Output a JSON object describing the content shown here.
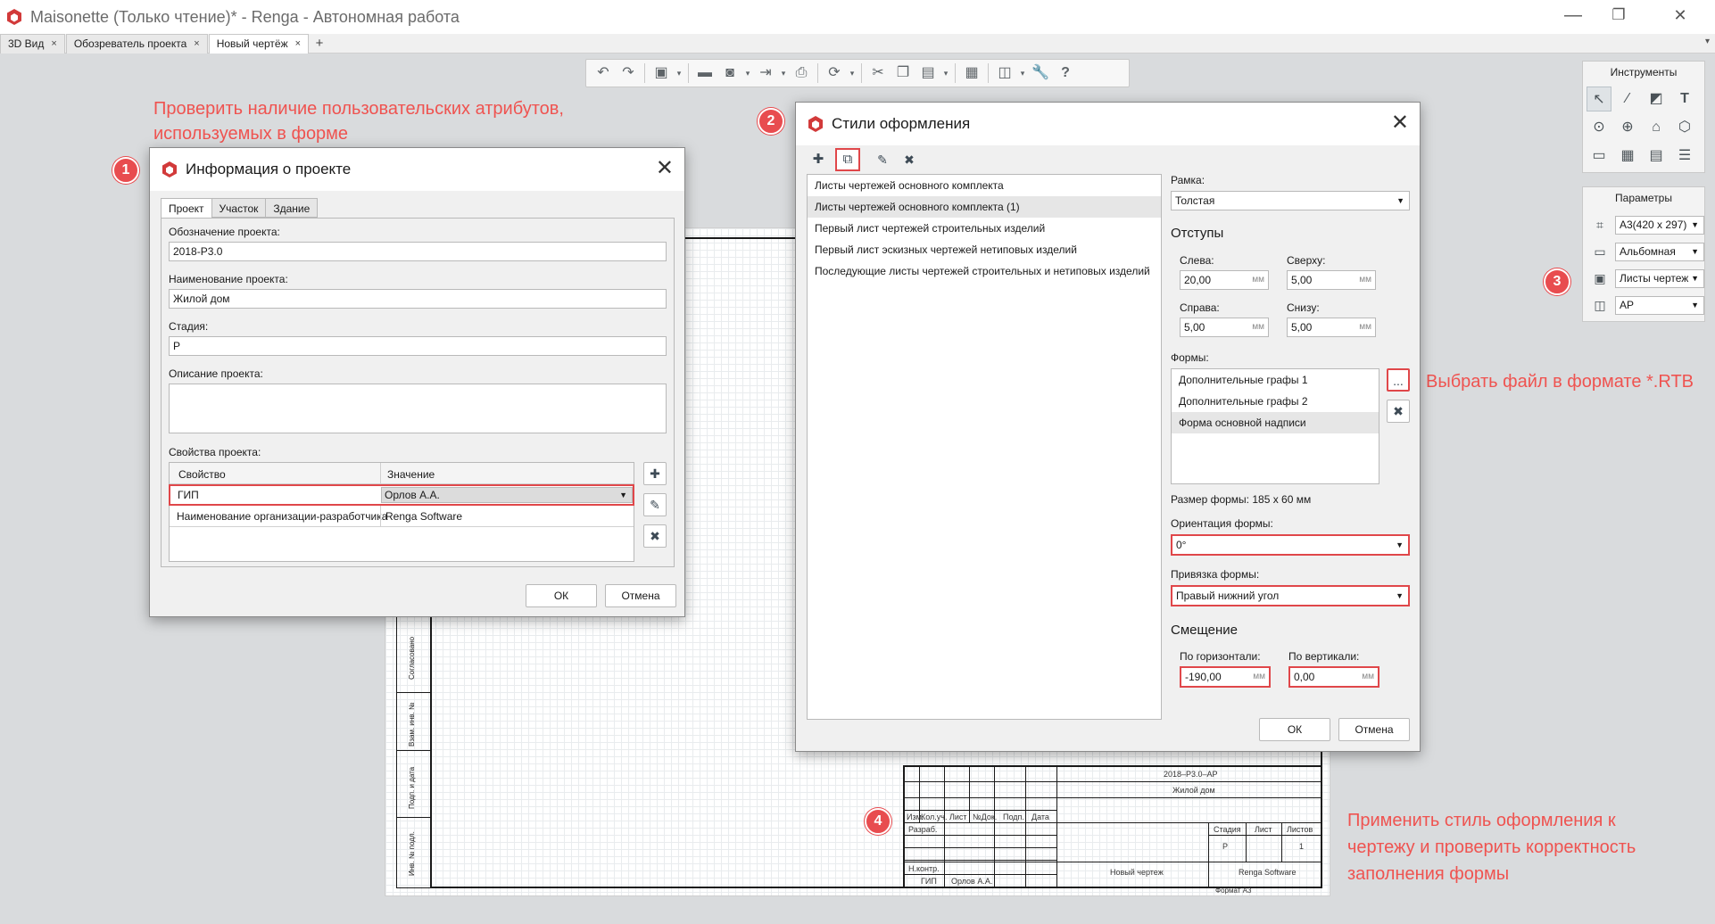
{
  "window": {
    "title": "Maisonette (Только чтение)* - Renga - Автономная работа",
    "minimize": "—",
    "restore": "❐",
    "close": "✕"
  },
  "tabs": [
    {
      "label": "3D Вид",
      "close": "×"
    },
    {
      "label": "Обозреватель проекта",
      "close": "×"
    },
    {
      "label": "Новый чертёж",
      "close": "×"
    }
  ],
  "tab_add": "+",
  "toolbar": {
    "icons": [
      "undo-icon",
      "redo-icon",
      "cube-icon",
      "open-folder-icon",
      "save-icon",
      "export-icon",
      "print-icon",
      "sync-icon",
      "cut-icon",
      "copy-icon",
      "paste-icon",
      "grid-icon",
      "layers-icon",
      "wrench-icon",
      "help-icon"
    ]
  },
  "annotations": {
    "a1_line1": "Проверить наличие пользовательских атрибутов,",
    "a1_line2": "используемых в форме",
    "a2": "Выбрать файл в формате *.RTB",
    "a4_line1": "Применить стиль оформления к",
    "a4_line2": "чертежу и проверить корректность",
    "a4_line3": "заполнения формы",
    "n1": "1",
    "n2": "2",
    "n3": "3",
    "n4": "4"
  },
  "project_dialog": {
    "title": "Информация о проекте",
    "close": "✕",
    "tabs": [
      "Проект",
      "Участок",
      "Здание"
    ],
    "designation_label": "Обозначение проекта:",
    "designation_value": "2018-Р3.0",
    "name_label": "Наименование проекта:",
    "name_value": "Жилой дом",
    "stage_label": "Стадия:",
    "stage_value": "Р",
    "description_label": "Описание проекта:",
    "description_value": "",
    "properties_label": "Свойства проекта:",
    "col_property": "Свойство",
    "col_value": "Значение",
    "rows": [
      {
        "property": "ГИП",
        "value": "Орлов А.А."
      },
      {
        "property": "Наименование организации-разработчика",
        "value": "Renga Software"
      }
    ],
    "ok": "ОК",
    "cancel": "Отмена"
  },
  "styles_dialog": {
    "title": "Стили оформления",
    "close": "✕",
    "list": [
      "Листы чертежей основного комплекта",
      "Листы чертежей основного комплекта (1)",
      "Первый лист чертежей строительных изделий",
      "Первый лист эскизных чертежей нетиповых изделий",
      "Последующие листы чертежей строительных и нетиповых изделий"
    ],
    "frame_label": "Рамка:",
    "frame_value": "Толстая",
    "margins_title": "Отступы",
    "left_label": "Слева:",
    "left_value": "20,00",
    "top_label": "Сверху:",
    "top_value": "5,00",
    "right_label": "Справа:",
    "right_value": "5,00",
    "bottom_label": "Снизу:",
    "bottom_value": "5,00",
    "unit": "мм",
    "forms_label": "Формы:",
    "forms": [
      "Дополнительные графы 1",
      "Дополнительные графы 2",
      "Форма основной надписи"
    ],
    "browse": "...",
    "form_size": "Размер формы: 185 х 60 мм",
    "orientation_label": "Ориентация формы:",
    "orientation_value": "0°",
    "anchor_label": "Привязка формы:",
    "anchor_value": "Правый нижний угол",
    "offset_title": "Смещение",
    "horiz_label": "По горизонтали:",
    "horiz_value": "-190,00",
    "vert_label": "По вертикали:",
    "vert_value": "0,00",
    "ok": "ОК",
    "cancel": "Отмена"
  },
  "tools_panel": {
    "title": "Инструменты"
  },
  "params_panel": {
    "title": "Параметры",
    "format": "А3(420 x 297)",
    "orientation": "Альбомная",
    "sheet_style": "Листы чертеж",
    "style_code": "АР"
  },
  "stamp": {
    "code": "2018–Р3.0–АР",
    "name": "Жилой дом",
    "col_izm": "Изм.",
    "col_kol": "Кол.уч.",
    "col_list": "Лист",
    "col_ndok": "№Док.",
    "col_podp": "Подп.",
    "col_data": "Дата",
    "razrab": "Разраб.",
    "stadiya": "Стадия",
    "list": "Лист",
    "listov": "Листов",
    "stage_val": "Р",
    "listov_val": "1",
    "nkontr": "Н.контр.",
    "gip": "ГИП",
    "gip_name": "Орлов А.А.",
    "drawing_name": "Новый чертеж",
    "org": "Renga Software",
    "format": "Формат А3"
  },
  "leftstrip": {
    "s1": "Согласовано",
    "s2": "Взам. инв. №",
    "s3": "Подп. и дата",
    "s4": "Инв. № подл."
  }
}
